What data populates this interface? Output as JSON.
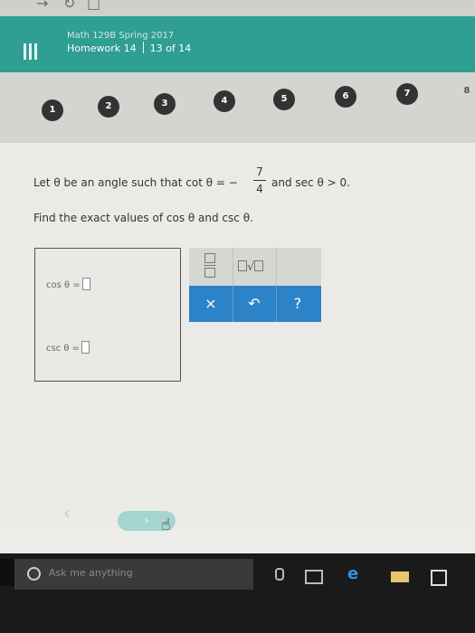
{
  "browser": {
    "glyphs": [
      "→",
      "↻",
      "□"
    ]
  },
  "header": {
    "menu_icon": "hamburger-icon",
    "course_title": "Math 129B Spring 2017",
    "assignment": "Homework 14",
    "progress": "13 of 14"
  },
  "question_nav": {
    "items": [
      "1",
      "2",
      "3",
      "4",
      "5",
      "6",
      "7",
      "8"
    ]
  },
  "problem": {
    "intro": "Let θ be an angle such that cot θ = −",
    "fraction_num": "7",
    "fraction_den": "4",
    "tail": "and sec θ > 0.",
    "instruction": "Find the exact values of cos θ and csc θ."
  },
  "answers": {
    "cos_label": "cos θ =",
    "csc_label": "csc θ ="
  },
  "palette": {
    "fraction_icon": "fraction-template-icon",
    "sqrt_icon": "square-root-icon",
    "sqrt_glyph": "√",
    "clear_label": "×",
    "undo_label": "↶",
    "help_label": "?"
  },
  "bottom_nav": {
    "back_glyph": "‹",
    "next_glyph": "›"
  },
  "taskbar": {
    "search_placeholder": "Ask me anything"
  },
  "colors": {
    "header_teal": "#2f9e93",
    "action_blue": "#2c83c7",
    "question_dark": "#333333",
    "next_button": "#a6d4ce",
    "taskbar": "#1a1a1a"
  }
}
